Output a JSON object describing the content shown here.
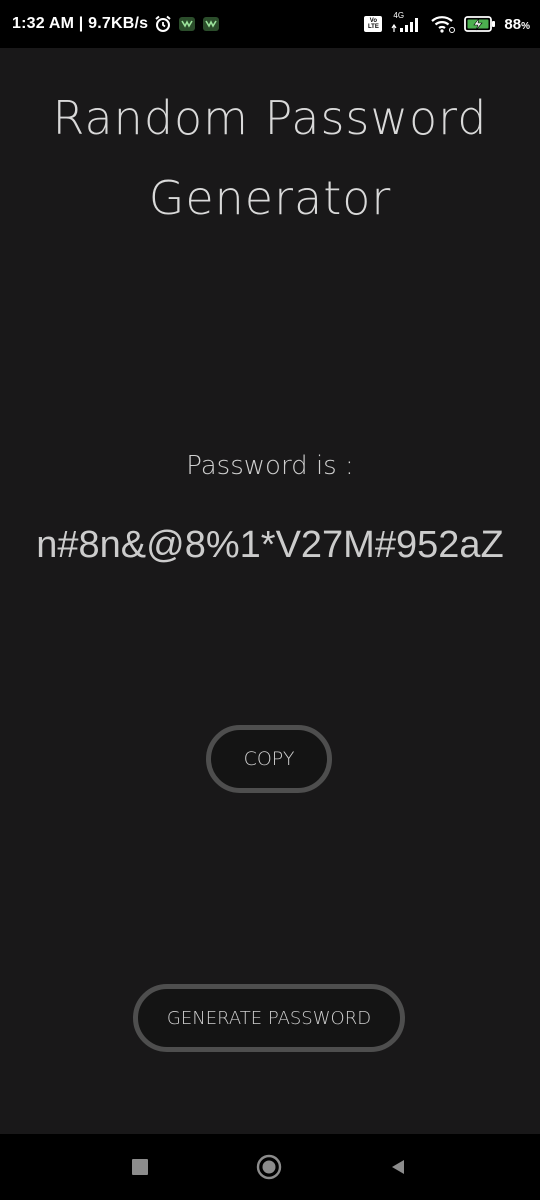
{
  "status_bar": {
    "time": "1:32 AM | 9.7KB/s",
    "network_label": "4G",
    "volte_label": "Vo LTE",
    "battery_percent": "88",
    "battery_unit": "%",
    "icons": [
      "alarm-icon",
      "app-notification-icon",
      "app-notification-icon",
      "volte-icon",
      "signal-icon",
      "wifi-icon",
      "battery-charging-icon"
    ]
  },
  "app": {
    "title_line1": "Random Password",
    "title_line2": "Generator",
    "password_label": "Password is :",
    "password_value": "n#8n&@8%1*V27M#952aZ",
    "copy_label": "COPY",
    "generate_label": "GENERATE PASSWORD"
  },
  "nav_bar": {
    "icons": [
      "recents-square-icon",
      "home-circle-icon",
      "back-triangle-icon"
    ]
  },
  "colors": {
    "background": "#191819",
    "text": "#d0d0d0",
    "button_border": "#4e4e4e",
    "battery_accent": "#4caf50"
  }
}
